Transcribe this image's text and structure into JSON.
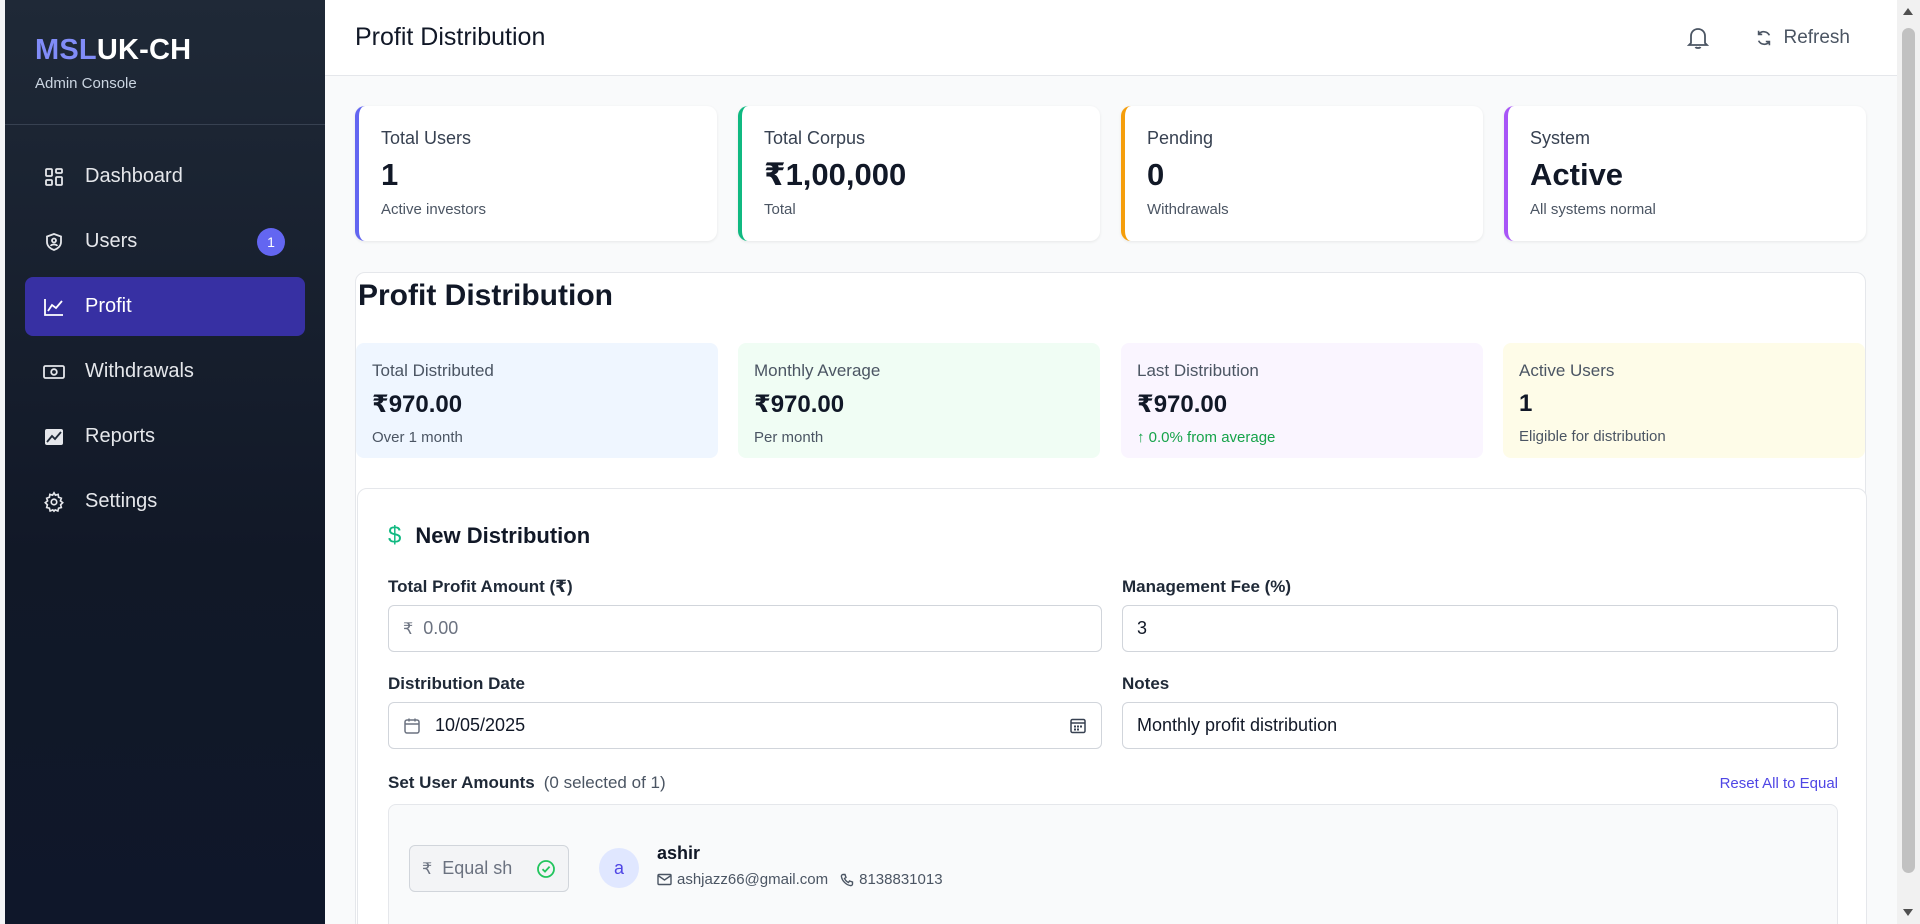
{
  "brand": {
    "part1": "MSL",
    "part2": "UK-CH",
    "subtitle": "Admin Console"
  },
  "sidebar": {
    "items": [
      {
        "label": "Dashboard",
        "icon": "grid-icon"
      },
      {
        "label": "Users",
        "icon": "shield-user-icon",
        "badge": "1"
      },
      {
        "label": "Profit",
        "icon": "trend-line-icon",
        "active": true
      },
      {
        "label": "Withdrawals",
        "icon": "cash-icon"
      },
      {
        "label": "Reports",
        "icon": "image-chart-icon"
      },
      {
        "label": "Settings",
        "icon": "gear-icon"
      }
    ]
  },
  "header": {
    "title": "Profit Distribution",
    "refresh_label": "Refresh"
  },
  "stats": [
    {
      "label": "Total Users",
      "value": "1",
      "sub": "Active investors",
      "color": "#6366f1"
    },
    {
      "label": "Total Corpus",
      "value": "₹1,00,000",
      "sub": "Total",
      "color": "#10b981"
    },
    {
      "label": "Pending",
      "value": "0",
      "sub": "Withdrawals",
      "color": "#f59e0b"
    },
    {
      "label": "System",
      "value": "Active",
      "sub": "All systems normal",
      "color": "#a855f7"
    }
  ],
  "panel": {
    "title": "Profit Distribution",
    "summary": [
      {
        "label": "Total Distributed",
        "value": "₹970.00",
        "sub": "Over 1 month",
        "bg": "#eff6ff",
        "subColor": "#4b5563"
      },
      {
        "label": "Monthly Average",
        "value": "₹970.00",
        "sub": "Per month",
        "bg": "#f0fdf4",
        "subColor": "#4b5563"
      },
      {
        "label": "Last Distribution",
        "value": "₹970.00",
        "sub": "↑ 0.0% from average",
        "bg": "#faf5ff",
        "subColor": "#16a34a"
      },
      {
        "label": "Active Users",
        "value": "1",
        "sub": "Eligible for distribution",
        "bg": "#fefce8",
        "subColor": "#4b5563"
      }
    ]
  },
  "form": {
    "title": "New Distribution",
    "total_profit_label": "Total Profit Amount (₹)",
    "total_profit_placeholder": "0.00",
    "currency": "₹",
    "fee_label": "Management Fee (%)",
    "fee_value": "3",
    "date_label": "Distribution Date",
    "date_value": "10/05/2025",
    "notes_label": "Notes",
    "notes_value": "Monthly profit distribution",
    "set_amounts_label": "Set User Amounts",
    "selected_count": "(0 selected of 1)",
    "reset_label": "Reset All to Equal"
  },
  "user": {
    "amount_placeholder": "Equal sh",
    "avatar_letter": "a",
    "name": "ashir",
    "email": "ashjazz66@gmail.com",
    "phone": "8138831013"
  }
}
